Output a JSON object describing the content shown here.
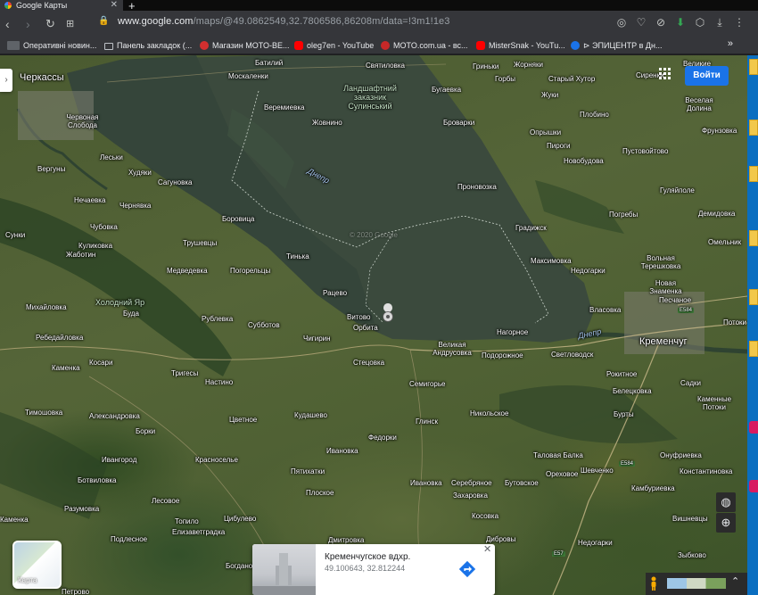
{
  "browser": {
    "tab_title": "Google Карты",
    "tab_close": "✕",
    "new_tab": "+",
    "url_domain": "www.google.com",
    "url_path": "/maps/@49.0862549,32.7806586,86208m/data=!3m1!1e3"
  },
  "bookmarks": [
    {
      "label": "Оперативні новин...",
      "icon": "unn-icon"
    },
    {
      "label": "Панель закладок (...",
      "icon": "folder-icon"
    },
    {
      "label": "Магазин MOTO-BE...",
      "icon": "moto-icon"
    },
    {
      "label": "oleg7en - YouTube",
      "icon": "youtube-icon"
    },
    {
      "label": "MOTO.com.ua - вс...",
      "icon": "moto-icon"
    },
    {
      "label": "MisterSnak - YouTu...",
      "icon": "youtube-icon"
    },
    {
      "label": "⊳ ЭПИЦЕНТР в Дн...",
      "icon": "epicenter-icon"
    }
  ],
  "bookmarks_more": "»",
  "map": {
    "signin_label": "Войти",
    "layers_label": "Карта",
    "watermark": "© 2020 Google",
    "places": [
      {
        "name": "Черкассы",
        "big": true
      },
      {
        "name": "Батилий"
      },
      {
        "name": "Святиловка"
      },
      {
        "name": "Гриньки"
      },
      {
        "name": "Жорняки"
      },
      {
        "name": "Великие"
      },
      {
        "name": "Москаленки"
      },
      {
        "name": "Бугаевка"
      },
      {
        "name": "Горбы"
      },
      {
        "name": "Старый Хутор"
      },
      {
        "name": "Сиренки"
      },
      {
        "name": "Червоная Слобода"
      },
      {
        "name": "Веремиевка"
      },
      {
        "name": "Жовнино"
      },
      {
        "name": "Жуки"
      },
      {
        "name": "Веселая Долина"
      },
      {
        "name": "Броварки"
      },
      {
        "name": "Опрышки"
      },
      {
        "name": "Плобино"
      },
      {
        "name": "Фрунзовка"
      },
      {
        "name": "Леськи"
      },
      {
        "name": "Пироги"
      },
      {
        "name": "Пустовойтово"
      },
      {
        "name": "Новобудова"
      },
      {
        "name": "Вергуны"
      },
      {
        "name": "Худяки"
      },
      {
        "name": "Сагуновка"
      },
      {
        "name": "Гуляйполе"
      },
      {
        "name": "Нечаевка"
      },
      {
        "name": "Чернявка"
      },
      {
        "name": "Проновозка"
      },
      {
        "name": "Демидовка"
      },
      {
        "name": "Боровица"
      },
      {
        "name": "Погребы"
      },
      {
        "name": "Градижск"
      },
      {
        "name": "Омельник"
      },
      {
        "name": "Сунки"
      },
      {
        "name": "Чубовка"
      },
      {
        "name": "Трушевцы"
      },
      {
        "name": "Максимовка"
      },
      {
        "name": "Вольная Терешковка"
      },
      {
        "name": "Куликовка"
      },
      {
        "name": "Тинька"
      },
      {
        "name": "Недогарки"
      },
      {
        "name": "Новая Знаменка"
      },
      {
        "name": "Жаботин"
      },
      {
        "name": "Медведевка"
      },
      {
        "name": "Погорельцы"
      },
      {
        "name": "Песчаное"
      },
      {
        "name": "Рацево"
      },
      {
        "name": "Михайловка"
      },
      {
        "name": "Буда"
      },
      {
        "name": "Власовка"
      },
      {
        "name": "Рублевка"
      },
      {
        "name": "Витово"
      },
      {
        "name": "Орбита"
      },
      {
        "name": "Потоки"
      },
      {
        "name": "Ребедайловка"
      },
      {
        "name": "Субботов"
      },
      {
        "name": "Чигирин"
      },
      {
        "name": "Нагорное"
      },
      {
        "name": "Кременчуг",
        "big": true
      },
      {
        "name": "Великая Андрусовка"
      },
      {
        "name": "Подорожное"
      },
      {
        "name": "Светловодск"
      },
      {
        "name": "Каменка"
      },
      {
        "name": "Косари"
      },
      {
        "name": "Стецовка"
      },
      {
        "name": "Рокитное"
      },
      {
        "name": "Тригесы"
      },
      {
        "name": "Настино"
      },
      {
        "name": "Семигорье"
      },
      {
        "name": "Белецковка"
      },
      {
        "name": "Садки"
      },
      {
        "name": "Каменные Потоки"
      },
      {
        "name": "Тимошовка"
      },
      {
        "name": "Александровка"
      },
      {
        "name": "Кудашево"
      },
      {
        "name": "Никольское"
      },
      {
        "name": "Бурты"
      },
      {
        "name": "Борки"
      },
      {
        "name": "Цветное"
      },
      {
        "name": "Глинск"
      },
      {
        "name": "Федорки"
      },
      {
        "name": "Ивановка"
      },
      {
        "name": "Таловая Балка"
      },
      {
        "name": "Онуфриевка"
      },
      {
        "name": "Ивангород"
      },
      {
        "name": "Красноселье"
      },
      {
        "name": "Пятихатки"
      },
      {
        "name": "Ивановка"
      },
      {
        "name": "Серебряное"
      },
      {
        "name": "Бутовское"
      },
      {
        "name": "Ореховое"
      },
      {
        "name": "Шевченко"
      },
      {
        "name": "Константиновка"
      },
      {
        "name": "Ботвиловка"
      },
      {
        "name": "Плоское"
      },
      {
        "name": "Захаровка"
      },
      {
        "name": "Камбуриевка"
      },
      {
        "name": "Разумовка"
      },
      {
        "name": "Лесовое"
      },
      {
        "name": "Топило"
      },
      {
        "name": "Цибулево"
      },
      {
        "name": "Косовка"
      },
      {
        "name": "Вишневцы"
      },
      {
        "name": "Каменка"
      },
      {
        "name": "Подлесное"
      },
      {
        "name": "Елизаветградка"
      },
      {
        "name": "Дмитровка"
      },
      {
        "name": "Дибровы"
      },
      {
        "name": "Недогарки"
      },
      {
        "name": "Зыбково"
      },
      {
        "name": "Богдановка"
      },
      {
        "name": "Петрово"
      }
    ],
    "green_label": "Ландшафтний заказник Сулинський",
    "green_label2": "Холодний Яр",
    "river_labels": [
      "Днепр",
      "Днепр"
    ],
    "roads": [
      "E584",
      "E584",
      "E57"
    ]
  },
  "infocard": {
    "title": "Кременчугское вдхр.",
    "coords": "49.100643, 32.812244",
    "close": "✕"
  },
  "controls": {
    "zoom_in": "+",
    "zoom_out": "−",
    "expand": "⌃"
  },
  "colors": {
    "accent": "#1a73e8",
    "water": "#3a4a3a",
    "land": "#4f5f34"
  }
}
